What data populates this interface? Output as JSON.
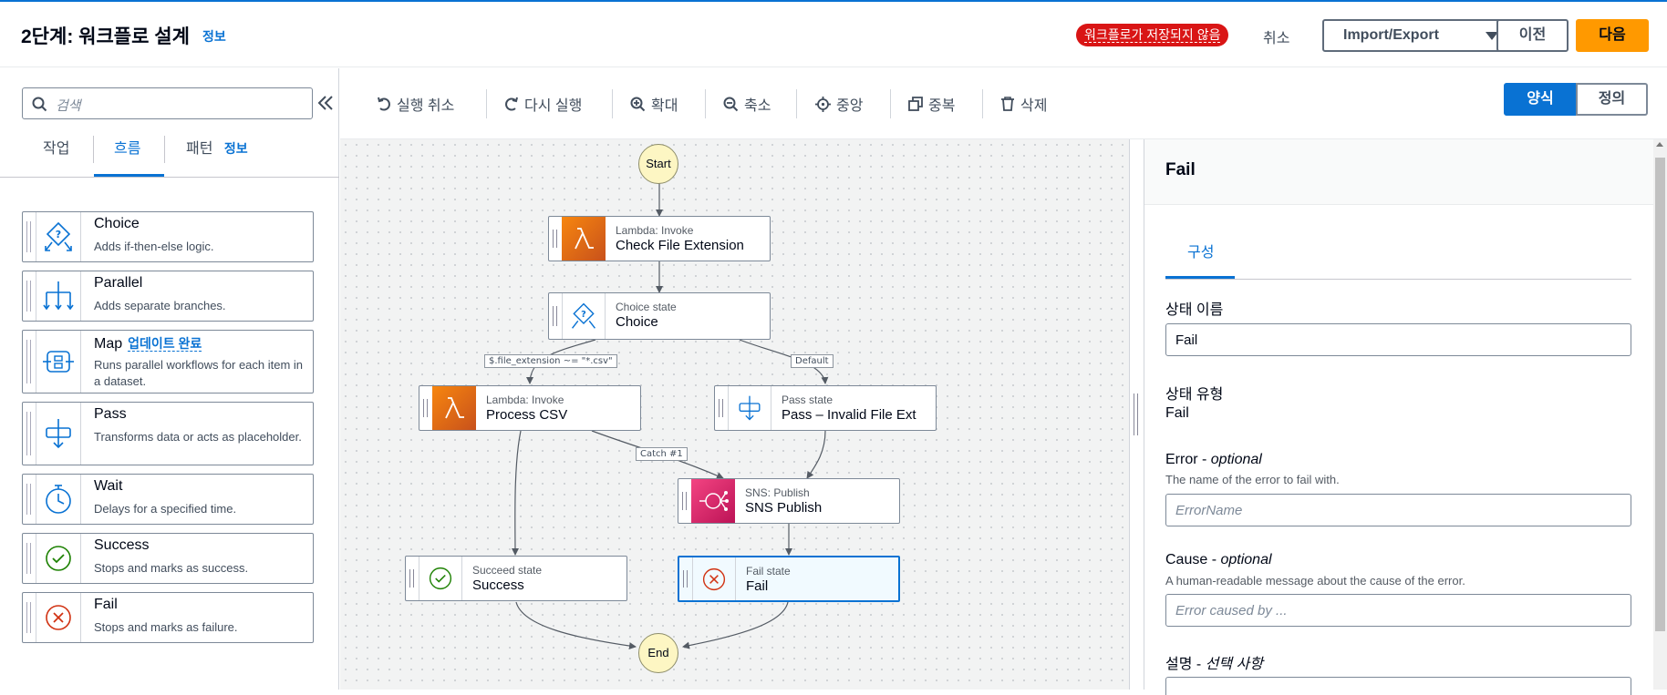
{
  "header": {
    "title": "2단계: 워크플로 설계",
    "info": "정보",
    "unsaved_badge": "워크플로가 저장되지 않음",
    "cancel": "취소",
    "import_export": "Import/Export",
    "previous": "이전",
    "next": "다음"
  },
  "left": {
    "search_placeholder": "검색",
    "tabs": [
      {
        "label": "작업"
      },
      {
        "label": "흐름"
      },
      {
        "label": "패턴"
      }
    ],
    "active_tab": "흐름",
    "pattern_info": "정보",
    "items": [
      {
        "title": "Choice",
        "desc": "Adds if-then-else logic.",
        "icon": "choice-icon"
      },
      {
        "title": "Parallel",
        "desc": "Adds separate branches.",
        "icon": "parallel-icon"
      },
      {
        "title": "Map",
        "badge": "업데이트 완료",
        "desc": "Runs parallel workflows for each item in a dataset.",
        "icon": "map-icon"
      },
      {
        "title": "Pass",
        "desc": "Transforms data or acts as placeholder.",
        "icon": "pass-icon"
      },
      {
        "title": "Wait",
        "desc": "Delays for a specified time.",
        "icon": "timer-icon"
      },
      {
        "title": "Success",
        "desc": "Stops and marks as success.",
        "icon": "check-circle-icon"
      },
      {
        "title": "Fail",
        "desc": "Stops and marks as failure.",
        "icon": "x-circle-icon"
      }
    ]
  },
  "toolbar": {
    "undo": "실행 취소",
    "redo": "다시 실행",
    "zoom_in": "확대",
    "zoom_out": "축소",
    "center": "중앙",
    "duplicate": "중복",
    "delete": "삭제",
    "mode_form": "양식",
    "mode_definition": "정의"
  },
  "graph": {
    "start": "Start",
    "end": "End",
    "nodes": {
      "check_ext": {
        "type": "Lambda: Invoke",
        "name": "Check File Extension"
      },
      "choice": {
        "type": "Choice state",
        "name": "Choice"
      },
      "process_csv": {
        "type": "Lambda: Invoke",
        "name": "Process CSV"
      },
      "invalid_ext": {
        "type": "Pass state",
        "name": "Pass – Invalid File Ext"
      },
      "sns": {
        "type": "SNS: Publish",
        "name": "SNS Publish"
      },
      "success": {
        "type": "Succeed state",
        "name": "Success"
      },
      "fail": {
        "type": "Fail state",
        "name": "Fail"
      }
    },
    "edge_labels": {
      "csv_rule": "$.file_extension ~= \"*.csv\"",
      "default": "Default",
      "catch": "Catch #1"
    }
  },
  "right": {
    "title": "Fail",
    "tab": "구성",
    "state_name_label": "상태 이름",
    "state_name_value": "Fail",
    "state_type_label": "상태 유형",
    "state_type_value": "Fail",
    "error_label": "Error - ",
    "error_optional": "optional",
    "error_desc": "The name of the error to fail with.",
    "error_placeholder": "ErrorName",
    "cause_label": "Cause - ",
    "cause_optional": "optional",
    "cause_desc": "A human-readable message about the cause of the error.",
    "cause_placeholder": "Error caused by ...",
    "desc_label": "설명 - ",
    "desc_optional": "선택 사항"
  },
  "colors": {
    "accent": "#0972d3",
    "primary_button": "#ff9900",
    "unsaved_badge": "#d91515",
    "lambda": "#e7740f",
    "sns": "#e7157b",
    "start_end": "#fdf6c3"
  }
}
